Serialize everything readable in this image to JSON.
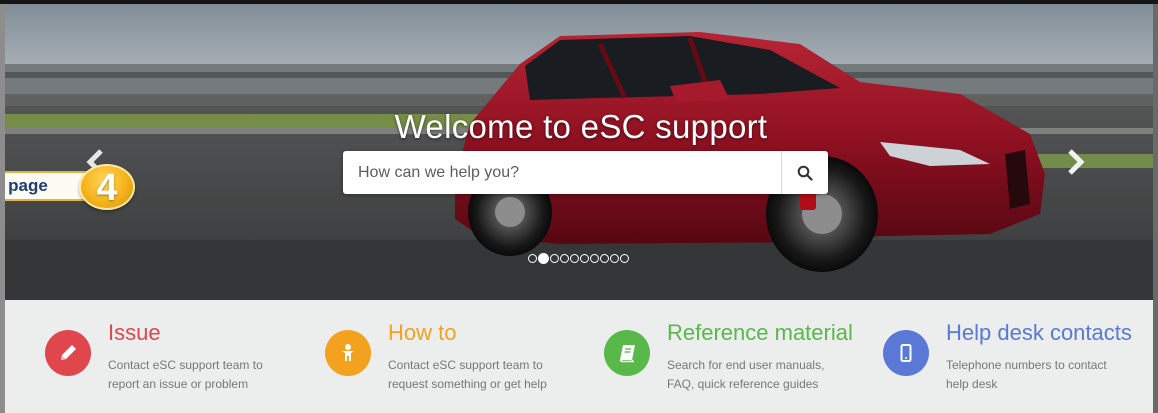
{
  "hero": {
    "title": "Welcome to eSC support",
    "search_placeholder": "How can we help you?",
    "slide_count": 10,
    "active_slide": 2
  },
  "callout": {
    "label": "e page",
    "number": "4"
  },
  "features": [
    {
      "title": "Issue",
      "desc": "Contact eSC support team to report an issue or problem",
      "color": "#e0474c",
      "icon": "pencil-icon"
    },
    {
      "title": "How to",
      "desc": "Contact eSC support team to request something or get help",
      "color": "#f2a21e",
      "icon": "person-icon"
    },
    {
      "title": "Reference material",
      "desc": "Search for end user manuals, FAQ, quick reference guides",
      "color": "#58b84a",
      "icon": "book-icon"
    },
    {
      "title": "Help desk contacts",
      "desc": "Telephone numbers to contact help desk",
      "color": "#5a78d6",
      "icon": "mobile-phone-icon"
    }
  ]
}
